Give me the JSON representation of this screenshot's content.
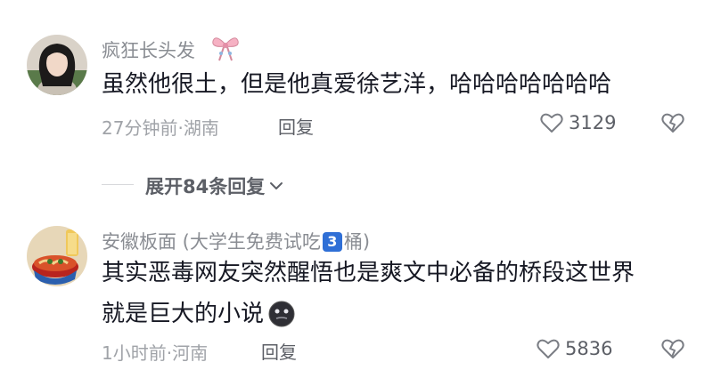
{
  "comments": [
    {
      "username": "疯狂长头发",
      "text": "虽然他很土，但是他真爱徐艺洋，哈哈哈哈哈哈哈",
      "time": "27分钟前",
      "location": "湖南",
      "reply_label": "回复",
      "likes": "3129",
      "avatar_icon": "avatar-girl-photo",
      "name_suffix_icon": "bow-sticker-icon"
    },
    {
      "username_pre": "安徽板面 (大学生免费试吃",
      "username_badge": "3",
      "username_post": "桶)",
      "text_line1": "其实恶毒网友突然醒悟也是爽文中必备的桥段这世界",
      "text_line2": "就是巨大的小说",
      "time": "1小时前",
      "location": "河南",
      "reply_label": "回复",
      "likes": "5836",
      "avatar_icon": "avatar-noodle-bowl",
      "emoji_icon": "dark-face-emoji-icon"
    }
  ],
  "expand_replies": {
    "label": "展开84条回复",
    "icon": "chevron-down-icon"
  },
  "colors": {
    "text_primary": "#161823",
    "text_secondary": "#8a8d93",
    "badge_blue": "#2f6fd6"
  }
}
